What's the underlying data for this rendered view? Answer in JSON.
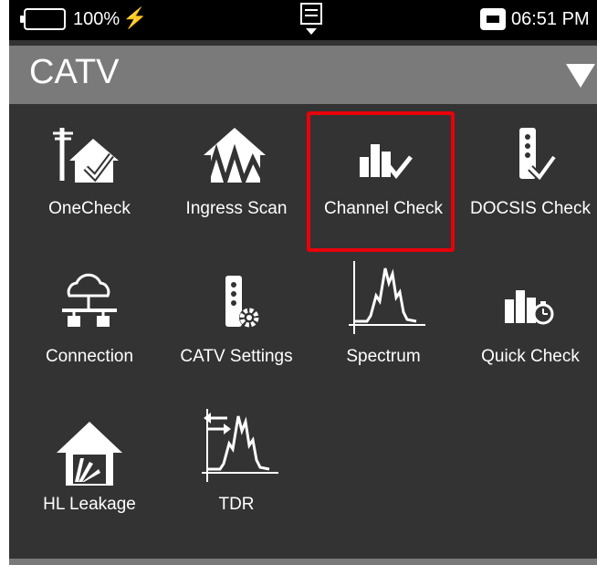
{
  "status_bar": {
    "battery": "100%",
    "time": "06:51 PM"
  },
  "header": {
    "title": "CATV"
  },
  "tiles": [
    {
      "label": "OneCheck",
      "icon": "onecheck-icon"
    },
    {
      "label": "Ingress Scan",
      "icon": "ingress-scan-icon"
    },
    {
      "label": "Channel Check",
      "icon": "channel-check-icon"
    },
    {
      "label": "DOCSIS Check",
      "icon": "docsis-check-icon"
    },
    {
      "label": "Connection",
      "icon": "connection-icon"
    },
    {
      "label": "CATV Settings",
      "icon": "catv-settings-icon"
    },
    {
      "label": "Spectrum",
      "icon": "spectrum-icon"
    },
    {
      "label": "Quick Check",
      "icon": "quick-check-icon"
    },
    {
      "label": "HL Leakage",
      "icon": "hl-leakage-icon"
    },
    {
      "label": "TDR",
      "icon": "tdr-icon"
    }
  ],
  "colors": {
    "highlight": "#e8000b",
    "background": "#333333",
    "header": "#7a7a7a"
  }
}
